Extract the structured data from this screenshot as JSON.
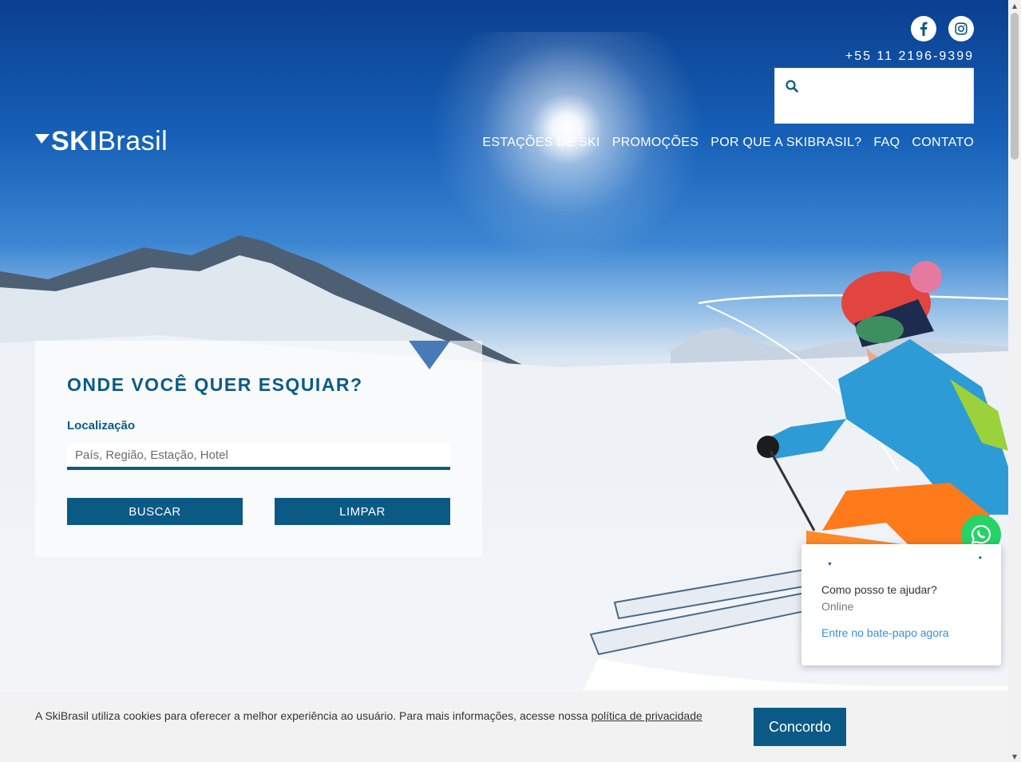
{
  "header": {
    "logo_ski": "SKI",
    "logo_brasil": "Brasil",
    "phone": "+55 11 2196-9399",
    "social": [
      {
        "name": "facebook-icon"
      },
      {
        "name": "instagram-icon"
      }
    ],
    "search": {
      "placeholder": ""
    }
  },
  "nav": {
    "items": [
      {
        "label": "ESTAÇÕES DE SKI"
      },
      {
        "label": "PROMOÇÕES"
      },
      {
        "label": "POR QUE A SKIBRASIL?"
      },
      {
        "label": "FAQ"
      },
      {
        "label": "CONTATO"
      }
    ]
  },
  "search_panel": {
    "title": "ONDE VOCÊ QUER ESQUIAR?",
    "location_label": "Localização",
    "location_placeholder": "País, Região, Estação, Hotel",
    "buscar_label": "BUSCAR",
    "limpar_label": "LIMPAR"
  },
  "chat": {
    "question": "Como posso te ajudar?",
    "status": "Online",
    "link": "Entre no bate-papo agora"
  },
  "cookie": {
    "message": "A SkiBrasil utiliza cookies para oferecer a melhor experiência ao usuário. Para mais informações, acesse nossa ",
    "link": "política de privacidade",
    "agree_label": "Concordo"
  },
  "colors": {
    "brand": "#0b5a86",
    "whatsapp": "#25d366",
    "chat_link": "#3a8fd9"
  }
}
